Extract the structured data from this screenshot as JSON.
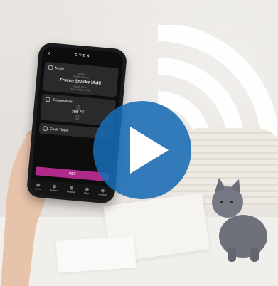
{
  "phone_app": {
    "brand": "OVEN",
    "mode": {
      "heading": "Mode",
      "above": "Defrost",
      "above2": "Frozen Snacks",
      "selected": "Frozen Snacks Multi",
      "below": "Frozen Pizza",
      "below2": "Frozen Pizza Multi"
    },
    "temperature": {
      "heading": "Temperature",
      "above2": "340",
      "above": "345",
      "value": "350",
      "unit": "°F",
      "below": "355",
      "below2": "360"
    },
    "cook_timer_label": "Cook Timer",
    "set_label": "SET",
    "nav": [
      "Home",
      "Devices",
      "Recipes",
      "Shop",
      "Account"
    ]
  },
  "video": {
    "play_icon": "play-icon",
    "play_color": "#1a6bb4"
  },
  "scene_icons": [
    "wifi-signal-icon"
  ]
}
